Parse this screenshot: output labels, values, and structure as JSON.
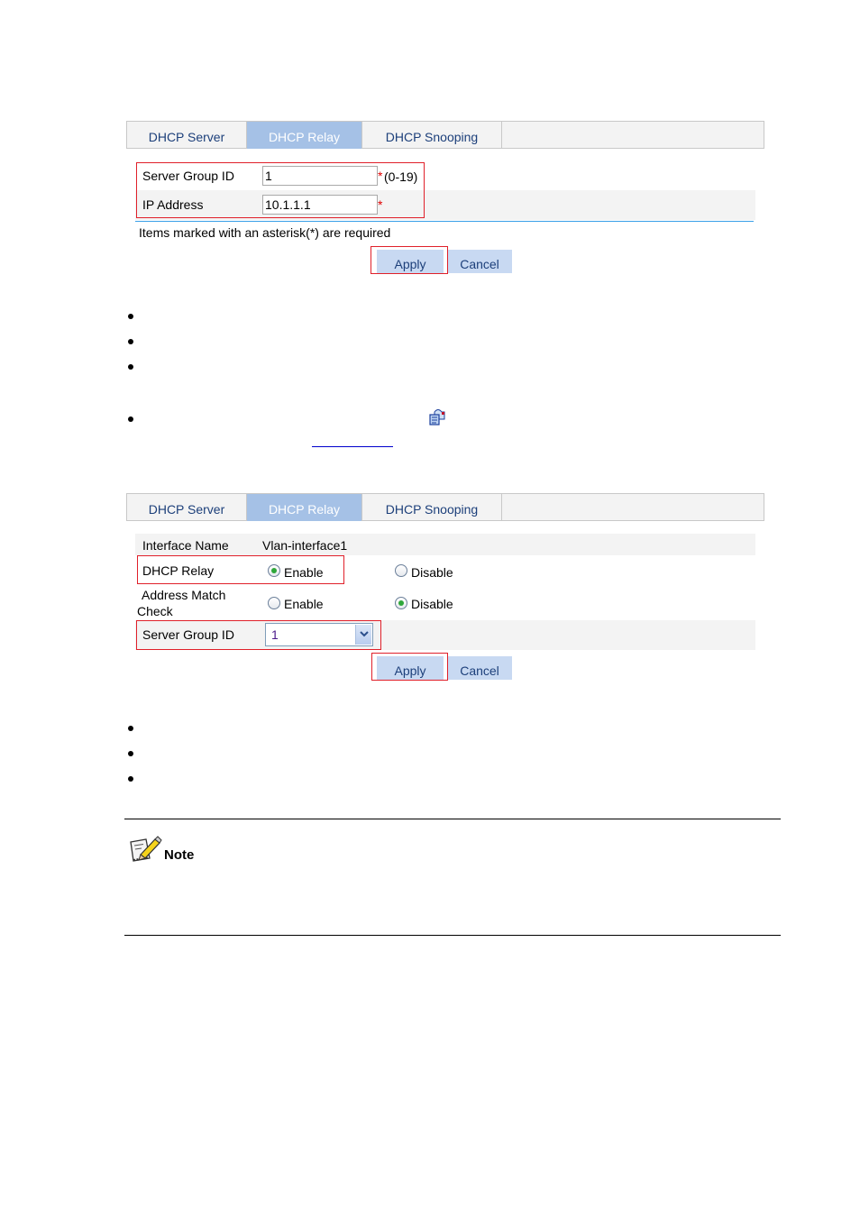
{
  "figure1": {
    "tabs": [
      {
        "label": "DHCP Server",
        "active": false
      },
      {
        "label": "DHCP Relay",
        "active": true
      },
      {
        "label": "DHCP Snooping",
        "active": false
      }
    ],
    "fields": {
      "server_group_id": {
        "label": "Server Group ID",
        "value": "1",
        "required_mark": "*",
        "hint": "(0-19)"
      },
      "ip_address": {
        "label": "IP Address",
        "value": "10.1.1.1",
        "required_mark": "*"
      }
    },
    "required_note": "Items marked with an asterisk(*) are required",
    "buttons": {
      "apply": "Apply",
      "cancel": "Cancel"
    }
  },
  "bullets_1": {
    "count": 4
  },
  "figure2": {
    "tabs": [
      {
        "label": "DHCP Server",
        "active": false
      },
      {
        "label": "DHCP Relay",
        "active": true
      },
      {
        "label": "DHCP Snooping",
        "active": false
      }
    ],
    "interface_name": {
      "label": "Interface Name",
      "value": "Vlan-interface1"
    },
    "dhcp_relay": {
      "label": "DHCP Relay",
      "options": [
        "Enable",
        "Disable"
      ],
      "selected": "Enable"
    },
    "address_match_check": {
      "label_line1": "Address Match",
      "label_line2": "Check",
      "options": [
        "Enable",
        "Disable"
      ],
      "selected": "Disable"
    },
    "server_group_id": {
      "label": "Server Group ID",
      "selected": "1"
    },
    "buttons": {
      "apply": "Apply",
      "cancel": "Cancel"
    }
  },
  "bullets_2": {
    "count": 3
  },
  "note": {
    "title": "Note",
    "icon": "note-pencil-icon"
  },
  "colors": {
    "tab_active_bg": "#a5c1e6",
    "tab_text": "#1c3f7a",
    "button_bg": "#c8d9f2",
    "highlight_box": "#e0202a",
    "required_star": "#e00000",
    "link_underline": "#0000cc"
  }
}
